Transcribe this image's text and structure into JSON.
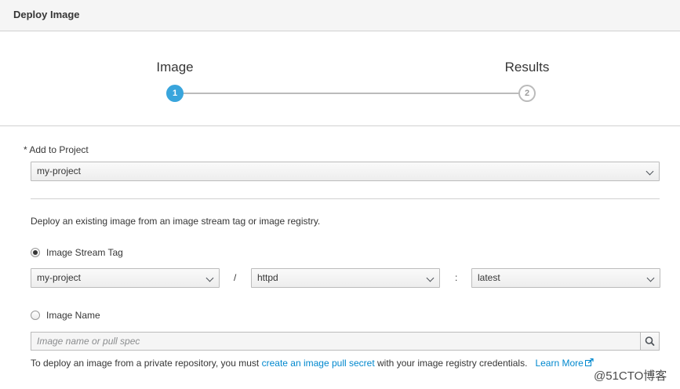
{
  "header": {
    "title": "Deploy Image"
  },
  "wizard": {
    "steps": [
      {
        "label": "Image",
        "number": "1",
        "active": true
      },
      {
        "label": "Results",
        "number": "2",
        "active": false
      }
    ]
  },
  "project": {
    "label": "* Add to Project",
    "value": "my-project"
  },
  "description": "Deploy an existing image from an image stream tag or image registry.",
  "stream_tag": {
    "label": "Image Stream Tag",
    "selected": true,
    "namespace": "my-project",
    "separator_slash": "/",
    "image_stream": "httpd",
    "separator_colon": ":",
    "tag": "latest"
  },
  "image_name": {
    "label": "Image Name",
    "selected": false,
    "placeholder": "Image name or pull spec"
  },
  "private_help": {
    "prefix": "To deploy an image from a private repository, you must",
    "link": "create an image pull secret",
    "suffix": "with your image registry credentials.",
    "learn_more": "Learn More"
  },
  "watermark": "@51CTO博客",
  "colors": {
    "accent": "#39a5dc",
    "link": "#0088ce",
    "border": "#bbbbbb"
  }
}
